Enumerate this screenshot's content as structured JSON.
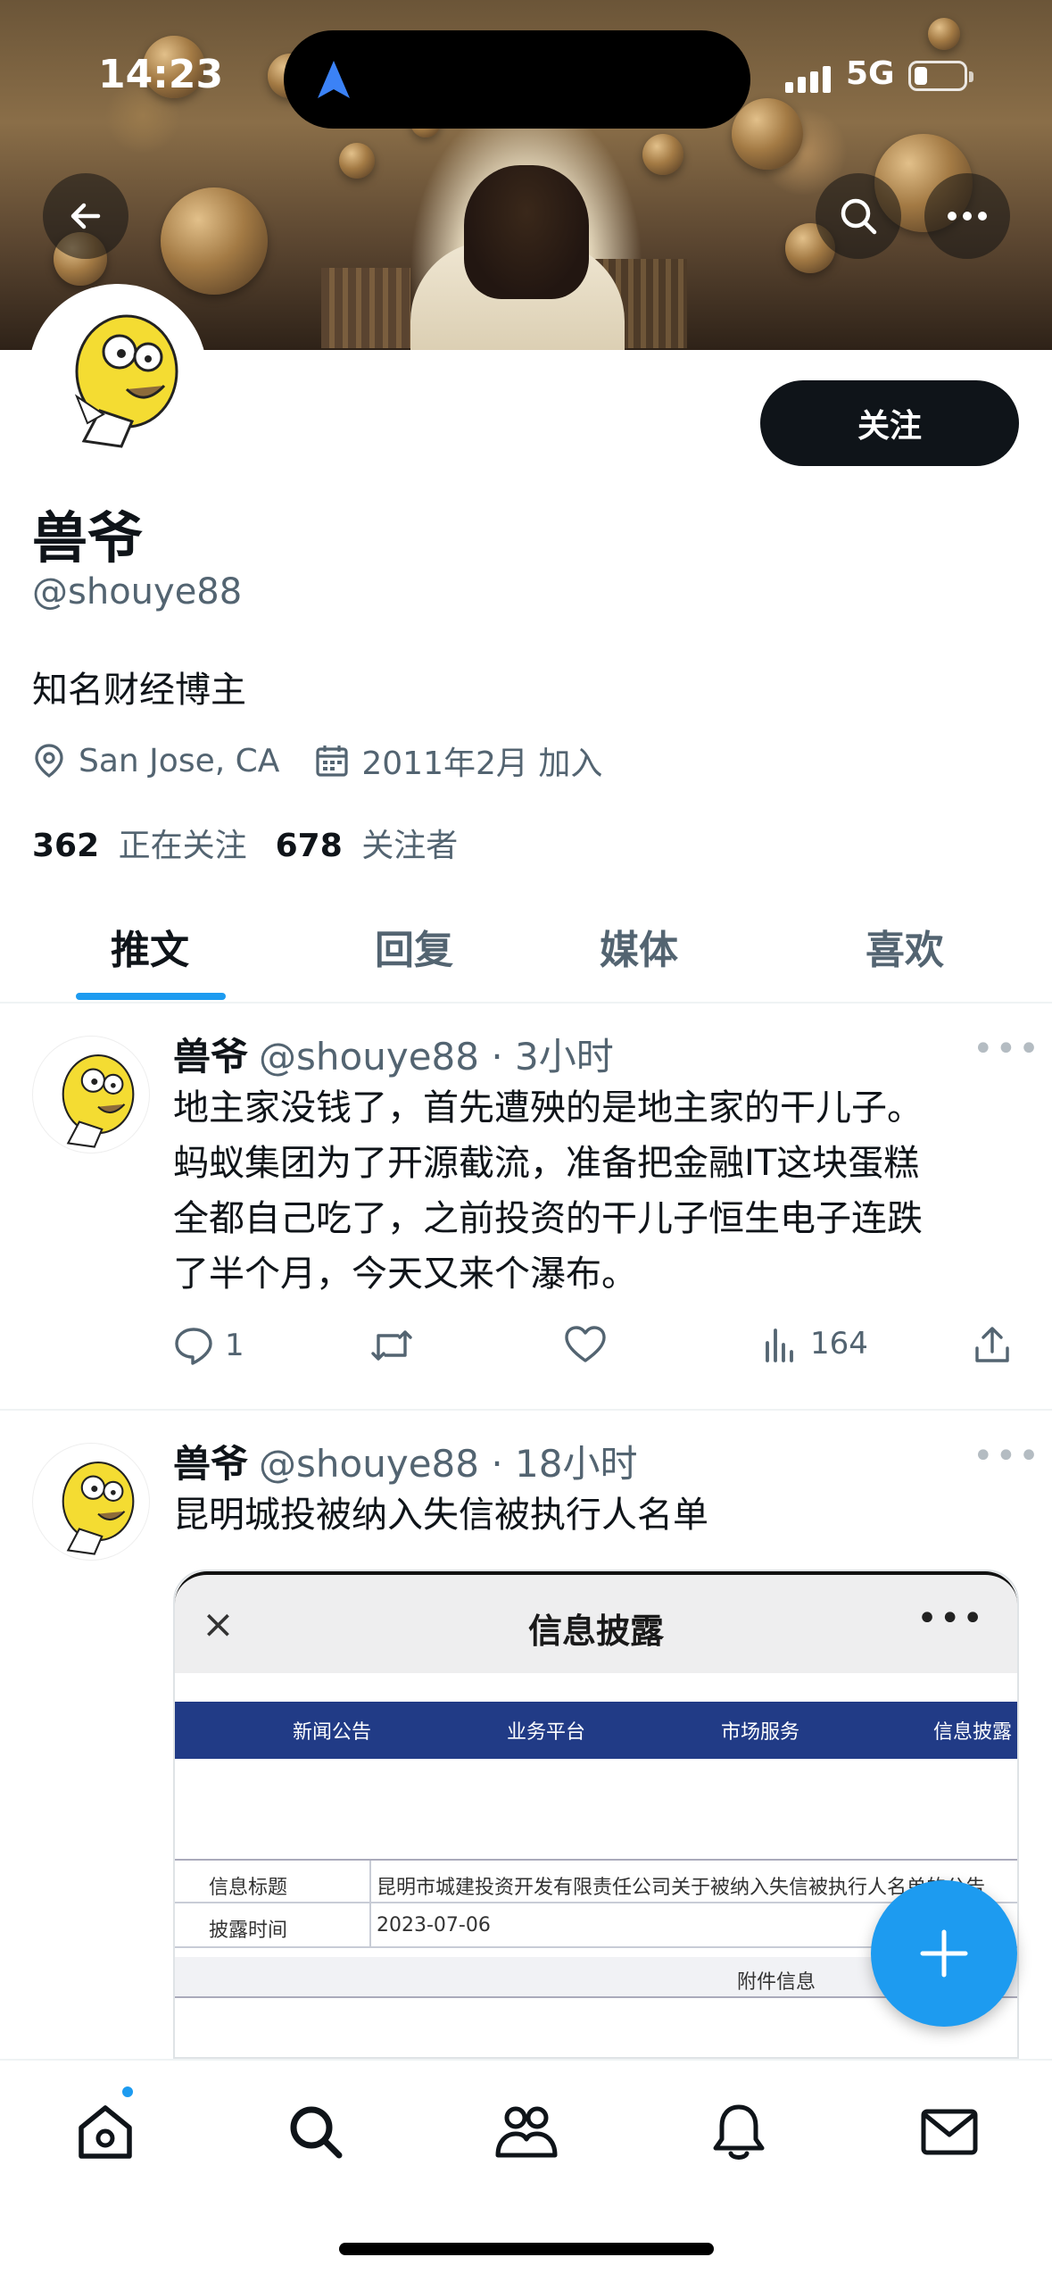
{
  "status_bar": {
    "time": "14:23",
    "network": "5G"
  },
  "profile": {
    "name": "兽爷",
    "handle": "@shouye88",
    "bio": "知名财经博主",
    "location": "San Jose, CA",
    "joined": "2011年2月 加入",
    "following_count": "362",
    "following_label": "正在关注",
    "followers_count": "678",
    "followers_label": "关注者",
    "follow_button": "关注"
  },
  "tabs": [
    {
      "label": "推文",
      "active": true
    },
    {
      "label": "回复",
      "active": false
    },
    {
      "label": "媒体",
      "active": false
    },
    {
      "label": "喜欢",
      "active": false
    }
  ],
  "tweets": [
    {
      "name": "兽爷",
      "handle": "@shouye88",
      "time": "3小时",
      "lines": [
        "地主家没钱了，首先遭殃的是地主家的干儿子。",
        "蚂蚁集团为了开源截流，准备把金融IT这块蛋糕",
        "全都自己吃了，之前投资的干儿子恒生电子连跌",
        "了半个月，今天又来个瀑布。"
      ],
      "replies": "1",
      "views": "164"
    },
    {
      "name": "兽爷",
      "handle": "@shouye88",
      "time": "18小时",
      "text": "昆明城投被纳入失信被执行人名单",
      "embed": {
        "title": "信息披露",
        "close": "×",
        "nav": [
          "新闻公告",
          "业务平台",
          "市场服务",
          "信息披露"
        ],
        "row1_key": "信息标题",
        "row1_value": "昆明市城建投资开发有限责任公司关于被纳入失信被执行人名单的公告",
        "row2_key": "披露时间",
        "row2_value": "2023-07-06",
        "attach": "附件信息"
      }
    }
  ],
  "icons": {
    "back": "arrow-left-icon",
    "search": "search-icon",
    "more": "more-icon",
    "location": "location-pin-icon",
    "calendar": "calendar-icon",
    "compose": "plus-icon"
  },
  "colors": {
    "accent": "#1d9bf0",
    "text": "#0f1419",
    "muted": "#536471"
  }
}
